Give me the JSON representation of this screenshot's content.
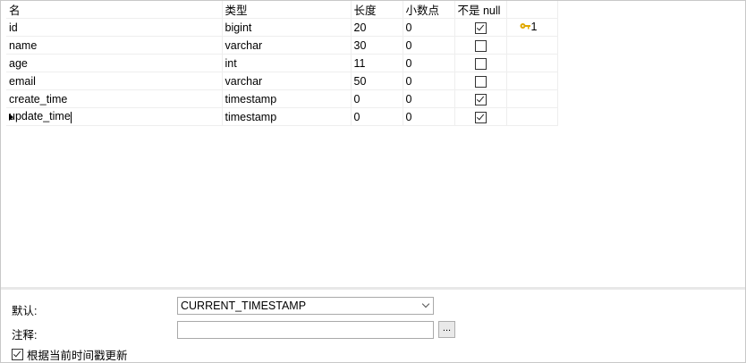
{
  "columns": [
    "名",
    "类型",
    "长度",
    "小数点",
    "不是 null",
    ""
  ],
  "rows": [
    {
      "name": "id",
      "type": "bigint",
      "length": "20",
      "decimals": "0",
      "not_null": true,
      "key": "1"
    },
    {
      "name": "name",
      "type": "varchar",
      "length": "30",
      "decimals": "0",
      "not_null": false,
      "key": ""
    },
    {
      "name": "age",
      "type": "int",
      "length": "11",
      "decimals": "0",
      "not_null": false,
      "key": ""
    },
    {
      "name": "email",
      "type": "varchar",
      "length": "50",
      "decimals": "0",
      "not_null": false,
      "key": ""
    },
    {
      "name": "create_time",
      "type": "timestamp",
      "length": "0",
      "decimals": "0",
      "not_null": true,
      "key": ""
    },
    {
      "name": "update_time",
      "type": "timestamp",
      "length": "0",
      "decimals": "0",
      "not_null": true,
      "key": ""
    }
  ],
  "current_row_index": 5,
  "icons": {
    "key": "key-icon",
    "row_pointer": "row-pointer-icon",
    "dropdown": "chevron-down-icon"
  },
  "props": {
    "default_label": "默认:",
    "default_value": "CURRENT_TIMESTAMP",
    "comment_label": "注释:",
    "comment_value": "",
    "browse_label": "...",
    "auto_update_label": "根据当前时间戳更新",
    "auto_update_checked": true
  },
  "colors": {
    "key_icon": "#e0a800",
    "border": "#a9a9a9"
  }
}
